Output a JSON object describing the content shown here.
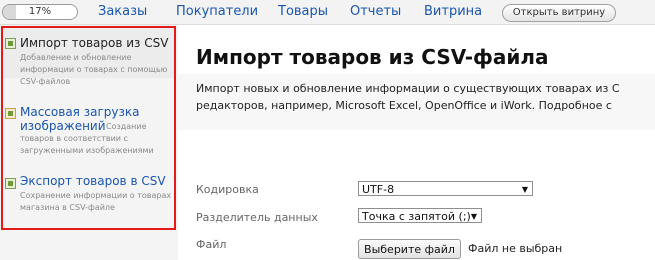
{
  "topbar": {
    "progress": {
      "label": "17%",
      "value": 0.17
    },
    "nav": [
      "Заказы",
      "Покупатели",
      "Товары",
      "Отчеты",
      "Витрина"
    ],
    "store_button": "Открыть витрину"
  },
  "sidebar": {
    "items": [
      {
        "title": "Импорт товаров из CSV",
        "description": "Добавление и обновление информации о товарах с помощью CSV-файлов"
      },
      {
        "title_line1": "Массовая загрузка",
        "title_line2": "изображений",
        "description_inline": "Создание",
        "description_rest": "товаров в соответствии с загруженными изображениями"
      },
      {
        "title": "Экспорт товаров в CSV",
        "description": "Сохранение информации о товарах магазина в CSV-файле"
      }
    ]
  },
  "main": {
    "title": "Импорт товаров из CSV-файла",
    "intro_line1": "Импорт новых и обновление информации о существующих товарах из C",
    "intro_line2": "редакторов, например, Microsoft Excel, OpenOffice и iWork. Подробное с",
    "fields": {
      "encoding_label": "Кодировка",
      "encoding_value": "UTF-8",
      "delimiter_label": "Разделитель данных",
      "delimiter_value": "Точка с запятой (;)",
      "file_label": "Файл",
      "file_button": "Выберите файл",
      "file_status": "Файл не выбран"
    }
  }
}
